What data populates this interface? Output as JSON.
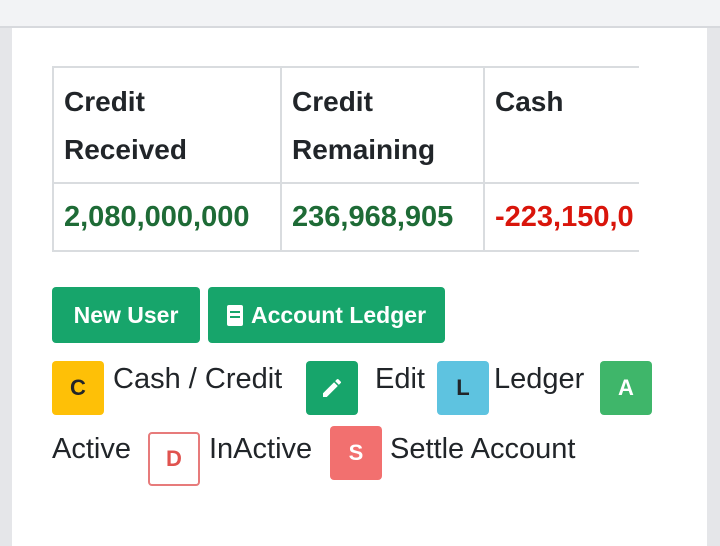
{
  "table": {
    "headers": [
      "Credit Received",
      "Credit Remaining",
      "Cash"
    ],
    "values": [
      "2,080,000,000",
      "236,968,905",
      "-223,150,0"
    ]
  },
  "buttons": {
    "new_user": "New User",
    "account_ledger": "Account Ledger"
  },
  "legend": {
    "c_badge": "C",
    "cash_credit": "Cash / Credit",
    "edit": "Edit",
    "l_badge": "L",
    "ledger": "Ledger",
    "a_badge": "A",
    "active": "Active",
    "d_badge": "D",
    "inactive": "InActive",
    "s_badge": "S",
    "settle": "Settle Account"
  },
  "colors": {
    "positive": "#1e6b36",
    "negative": "#d9150b",
    "primary_button": "#17a56b"
  },
  "icons": {
    "ledger_button": "book-icon",
    "edit_badge": "pencil-icon"
  }
}
